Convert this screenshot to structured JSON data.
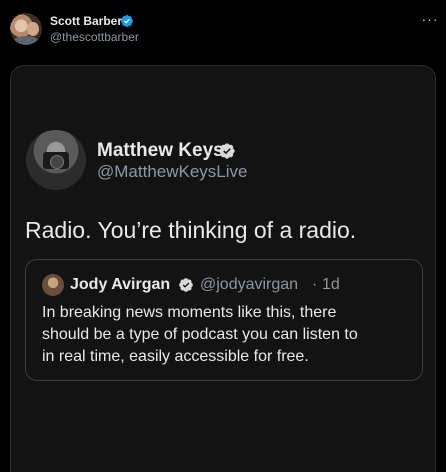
{
  "post": {
    "author_name": "Scott Barber",
    "author_handle": "@thescottbarber",
    "more_label": "···",
    "verified_icon": "verified-badge-icon",
    "accent_color": "#1d9bf0"
  },
  "screenshot": {
    "author_name": "Matthew Keys",
    "author_handle": "@MatthewKeysLive",
    "text": "Radio. You’re thinking of a radio.",
    "quote": {
      "author_name": "Jody Avirgan",
      "author_handle": "@jodyavirgan",
      "separator": "·",
      "time": "1d",
      "lines": [
        "In breaking news moments like this, there",
        "should be a type of podcast you can listen to",
        "in real time, easily accessible for free."
      ]
    }
  }
}
